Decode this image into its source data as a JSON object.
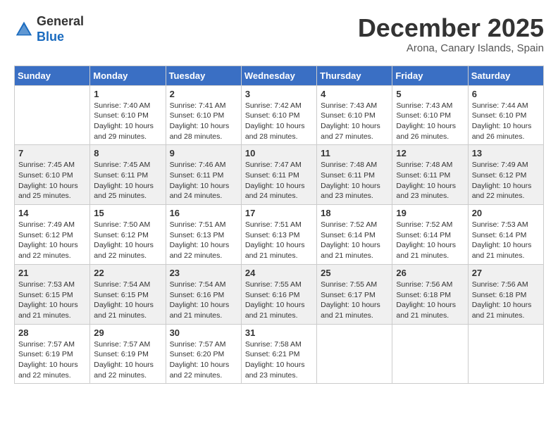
{
  "logo": {
    "general": "General",
    "blue": "Blue"
  },
  "title": "December 2025",
  "location": "Arona, Canary Islands, Spain",
  "days_of_week": [
    "Sunday",
    "Monday",
    "Tuesday",
    "Wednesday",
    "Thursday",
    "Friday",
    "Saturday"
  ],
  "weeks": [
    [
      {
        "day": "",
        "info": ""
      },
      {
        "day": "1",
        "info": "Sunrise: 7:40 AM\nSunset: 6:10 PM\nDaylight: 10 hours\nand 29 minutes."
      },
      {
        "day": "2",
        "info": "Sunrise: 7:41 AM\nSunset: 6:10 PM\nDaylight: 10 hours\nand 28 minutes."
      },
      {
        "day": "3",
        "info": "Sunrise: 7:42 AM\nSunset: 6:10 PM\nDaylight: 10 hours\nand 28 minutes."
      },
      {
        "day": "4",
        "info": "Sunrise: 7:43 AM\nSunset: 6:10 PM\nDaylight: 10 hours\nand 27 minutes."
      },
      {
        "day": "5",
        "info": "Sunrise: 7:43 AM\nSunset: 6:10 PM\nDaylight: 10 hours\nand 26 minutes."
      },
      {
        "day": "6",
        "info": "Sunrise: 7:44 AM\nSunset: 6:10 PM\nDaylight: 10 hours\nand 26 minutes."
      }
    ],
    [
      {
        "day": "7",
        "info": "Sunrise: 7:45 AM\nSunset: 6:10 PM\nDaylight: 10 hours\nand 25 minutes."
      },
      {
        "day": "8",
        "info": "Sunrise: 7:45 AM\nSunset: 6:11 PM\nDaylight: 10 hours\nand 25 minutes."
      },
      {
        "day": "9",
        "info": "Sunrise: 7:46 AM\nSunset: 6:11 PM\nDaylight: 10 hours\nand 24 minutes."
      },
      {
        "day": "10",
        "info": "Sunrise: 7:47 AM\nSunset: 6:11 PM\nDaylight: 10 hours\nand 24 minutes."
      },
      {
        "day": "11",
        "info": "Sunrise: 7:48 AM\nSunset: 6:11 PM\nDaylight: 10 hours\nand 23 minutes."
      },
      {
        "day": "12",
        "info": "Sunrise: 7:48 AM\nSunset: 6:11 PM\nDaylight: 10 hours\nand 23 minutes."
      },
      {
        "day": "13",
        "info": "Sunrise: 7:49 AM\nSunset: 6:12 PM\nDaylight: 10 hours\nand 22 minutes."
      }
    ],
    [
      {
        "day": "14",
        "info": "Sunrise: 7:49 AM\nSunset: 6:12 PM\nDaylight: 10 hours\nand 22 minutes."
      },
      {
        "day": "15",
        "info": "Sunrise: 7:50 AM\nSunset: 6:12 PM\nDaylight: 10 hours\nand 22 minutes."
      },
      {
        "day": "16",
        "info": "Sunrise: 7:51 AM\nSunset: 6:13 PM\nDaylight: 10 hours\nand 22 minutes."
      },
      {
        "day": "17",
        "info": "Sunrise: 7:51 AM\nSunset: 6:13 PM\nDaylight: 10 hours\nand 21 minutes."
      },
      {
        "day": "18",
        "info": "Sunrise: 7:52 AM\nSunset: 6:14 PM\nDaylight: 10 hours\nand 21 minutes."
      },
      {
        "day": "19",
        "info": "Sunrise: 7:52 AM\nSunset: 6:14 PM\nDaylight: 10 hours\nand 21 minutes."
      },
      {
        "day": "20",
        "info": "Sunrise: 7:53 AM\nSunset: 6:14 PM\nDaylight: 10 hours\nand 21 minutes."
      }
    ],
    [
      {
        "day": "21",
        "info": "Sunrise: 7:53 AM\nSunset: 6:15 PM\nDaylight: 10 hours\nand 21 minutes."
      },
      {
        "day": "22",
        "info": "Sunrise: 7:54 AM\nSunset: 6:15 PM\nDaylight: 10 hours\nand 21 minutes."
      },
      {
        "day": "23",
        "info": "Sunrise: 7:54 AM\nSunset: 6:16 PM\nDaylight: 10 hours\nand 21 minutes."
      },
      {
        "day": "24",
        "info": "Sunrise: 7:55 AM\nSunset: 6:16 PM\nDaylight: 10 hours\nand 21 minutes."
      },
      {
        "day": "25",
        "info": "Sunrise: 7:55 AM\nSunset: 6:17 PM\nDaylight: 10 hours\nand 21 minutes."
      },
      {
        "day": "26",
        "info": "Sunrise: 7:56 AM\nSunset: 6:18 PM\nDaylight: 10 hours\nand 21 minutes."
      },
      {
        "day": "27",
        "info": "Sunrise: 7:56 AM\nSunset: 6:18 PM\nDaylight: 10 hours\nand 21 minutes."
      }
    ],
    [
      {
        "day": "28",
        "info": "Sunrise: 7:57 AM\nSunset: 6:19 PM\nDaylight: 10 hours\nand 22 minutes."
      },
      {
        "day": "29",
        "info": "Sunrise: 7:57 AM\nSunset: 6:19 PM\nDaylight: 10 hours\nand 22 minutes."
      },
      {
        "day": "30",
        "info": "Sunrise: 7:57 AM\nSunset: 6:20 PM\nDaylight: 10 hours\nand 22 minutes."
      },
      {
        "day": "31",
        "info": "Sunrise: 7:58 AM\nSunset: 6:21 PM\nDaylight: 10 hours\nand 23 minutes."
      },
      {
        "day": "",
        "info": ""
      },
      {
        "day": "",
        "info": ""
      },
      {
        "day": "",
        "info": ""
      }
    ]
  ]
}
